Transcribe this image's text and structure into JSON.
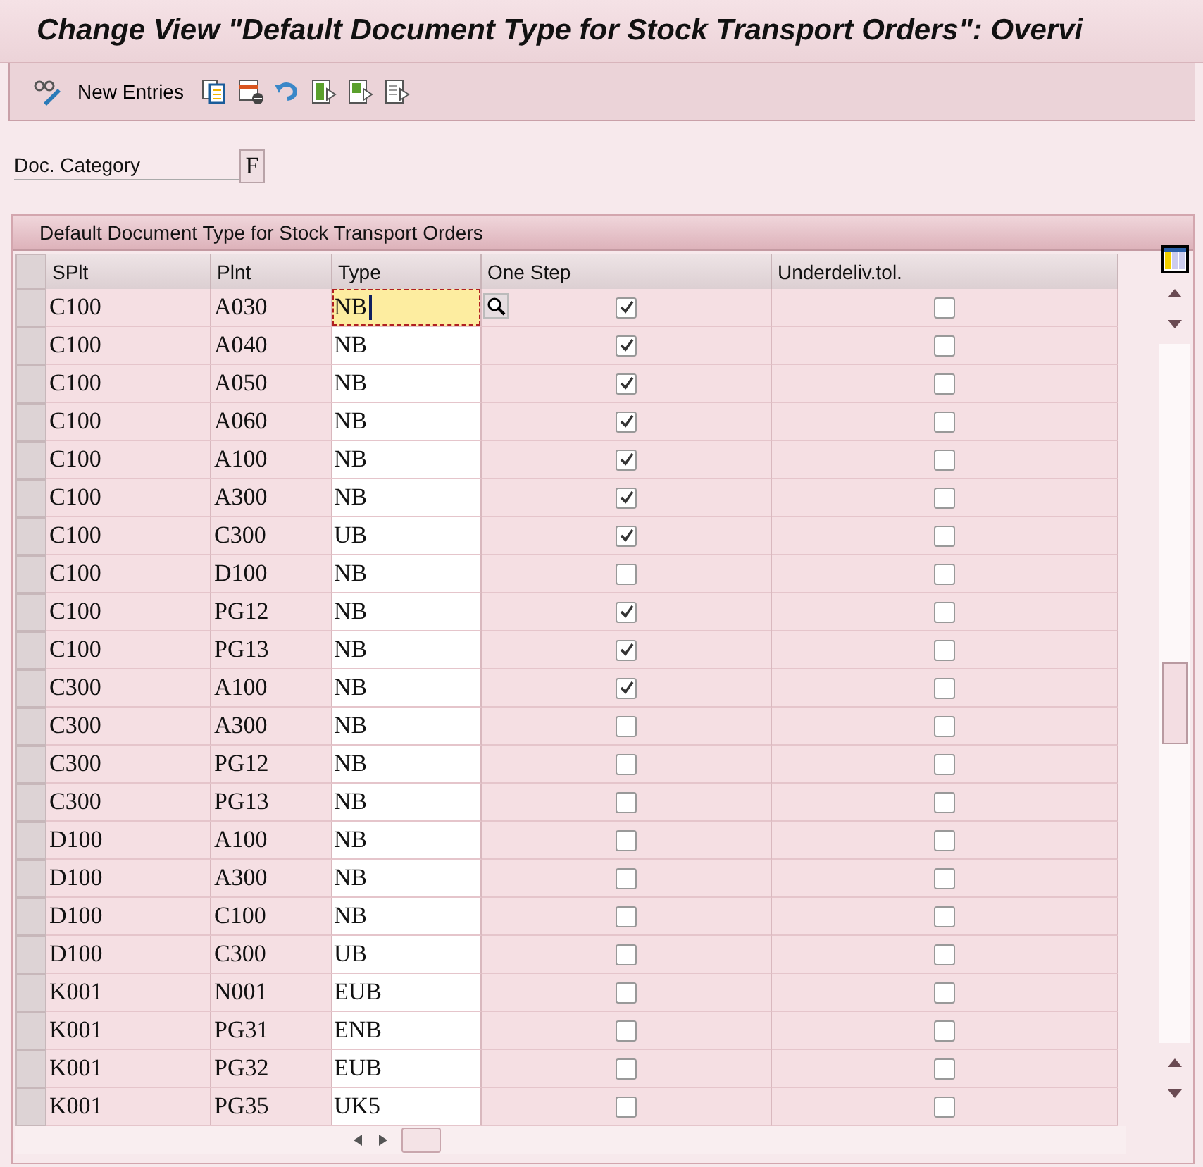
{
  "window": {
    "title": "Change View \"Default Document Type for Stock Transport Orders\": Overvi"
  },
  "toolbar": {
    "new_entries": "New Entries"
  },
  "doc_category": {
    "label": "Doc. Category",
    "value": "F"
  },
  "table": {
    "title": "Default Document Type for Stock Transport Orders",
    "columns": [
      "SPlt",
      "Plnt",
      "Type",
      "One Step",
      "Underdeliv.tol."
    ],
    "rows": [
      {
        "splt": "C100",
        "plnt": "A030",
        "type": "NB",
        "one_step": true,
        "underdeliv": false,
        "focused": true
      },
      {
        "splt": "C100",
        "plnt": "A040",
        "type": "NB",
        "one_step": true,
        "underdeliv": false,
        "focused": false
      },
      {
        "splt": "C100",
        "plnt": "A050",
        "type": "NB",
        "one_step": true,
        "underdeliv": false,
        "focused": false
      },
      {
        "splt": "C100",
        "plnt": "A060",
        "type": "NB",
        "one_step": true,
        "underdeliv": false,
        "focused": false
      },
      {
        "splt": "C100",
        "plnt": "A100",
        "type": "NB",
        "one_step": true,
        "underdeliv": false,
        "focused": false
      },
      {
        "splt": "C100",
        "plnt": "A300",
        "type": "NB",
        "one_step": true,
        "underdeliv": false,
        "focused": false
      },
      {
        "splt": "C100",
        "plnt": "C300",
        "type": "UB",
        "one_step": true,
        "underdeliv": false,
        "focused": false
      },
      {
        "splt": "C100",
        "plnt": "D100",
        "type": "NB",
        "one_step": false,
        "underdeliv": false,
        "focused": false
      },
      {
        "splt": "C100",
        "plnt": "PG12",
        "type": "NB",
        "one_step": true,
        "underdeliv": false,
        "focused": false
      },
      {
        "splt": "C100",
        "plnt": "PG13",
        "type": "NB",
        "one_step": true,
        "underdeliv": false,
        "focused": false
      },
      {
        "splt": "C300",
        "plnt": "A100",
        "type": "NB",
        "one_step": true,
        "underdeliv": false,
        "focused": false
      },
      {
        "splt": "C300",
        "plnt": "A300",
        "type": "NB",
        "one_step": false,
        "underdeliv": false,
        "focused": false
      },
      {
        "splt": "C300",
        "plnt": "PG12",
        "type": "NB",
        "one_step": false,
        "underdeliv": false,
        "focused": false
      },
      {
        "splt": "C300",
        "plnt": "PG13",
        "type": "NB",
        "one_step": false,
        "underdeliv": false,
        "focused": false
      },
      {
        "splt": "D100",
        "plnt": "A100",
        "type": "NB",
        "one_step": false,
        "underdeliv": false,
        "focused": false
      },
      {
        "splt": "D100",
        "plnt": "A300",
        "type": "NB",
        "one_step": false,
        "underdeliv": false,
        "focused": false
      },
      {
        "splt": "D100",
        "plnt": "C100",
        "type": "NB",
        "one_step": false,
        "underdeliv": false,
        "focused": false
      },
      {
        "splt": "D100",
        "plnt": "C300",
        "type": "UB",
        "one_step": false,
        "underdeliv": false,
        "focused": false
      },
      {
        "splt": "K001",
        "plnt": "N001",
        "type": "EUB",
        "one_step": false,
        "underdeliv": false,
        "focused": false
      },
      {
        "splt": "K001",
        "plnt": "PG31",
        "type": "ENB",
        "one_step": false,
        "underdeliv": false,
        "focused": false
      },
      {
        "splt": "K001",
        "plnt": "PG32",
        "type": "EUB",
        "one_step": false,
        "underdeliv": false,
        "focused": false
      },
      {
        "splt": "K001",
        "plnt": "PG35",
        "type": "UK5",
        "one_step": false,
        "underdeliv": false,
        "focused": false
      }
    ]
  }
}
